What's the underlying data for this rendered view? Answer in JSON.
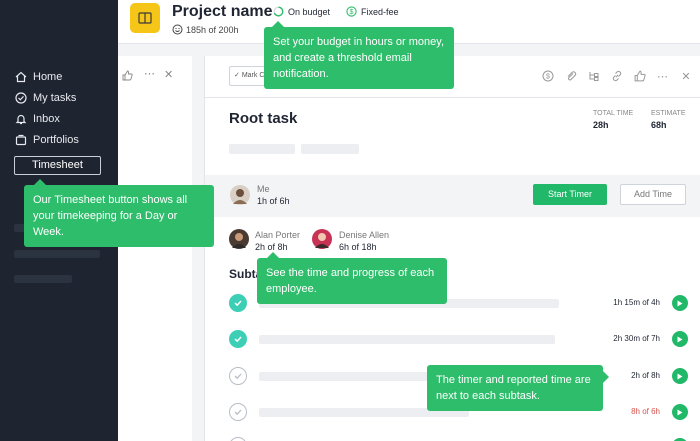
{
  "sidebar": {
    "items": [
      {
        "label": "Home",
        "icon": "home-icon"
      },
      {
        "label": "My tasks",
        "icon": "check-circle-icon"
      },
      {
        "label": "Inbox",
        "icon": "bell-icon"
      },
      {
        "label": "Portfolios",
        "icon": "folders-icon"
      }
    ],
    "timesheet_label": "Timesheet"
  },
  "header": {
    "project_name": "Project name",
    "budget_usage": "185h of 200h",
    "budget_status": "On budget",
    "billing_type": "Fixed-fee"
  },
  "task": {
    "mark_label": "Mark C",
    "title": "Root task",
    "total_time_label": "TOTAL TIME",
    "total_time": "28h",
    "estimate_label": "ESTIMATE",
    "estimate": "68h"
  },
  "people": {
    "me": {
      "name": "Me",
      "time": "1h of 6h"
    },
    "start_timer": "Start Timer",
    "add_time": "Add Time",
    "others": [
      {
        "name": "Alan Porter",
        "time": "2h of 8h"
      },
      {
        "name": "Denise Allen",
        "time": "6h of 18h"
      }
    ]
  },
  "subtasks": {
    "title": "Subta",
    "items": [
      {
        "time": "1h 15m of 4h",
        "done": true,
        "over": false
      },
      {
        "time": "2h 30m of 7h",
        "done": true,
        "over": false
      },
      {
        "time": "2h of 8h",
        "done": false,
        "over": false
      },
      {
        "time": "8h of 6h",
        "done": false,
        "over": true
      }
    ]
  },
  "tooltips": {
    "budget": "Set your budget in hours or money, and create a threshold email notification.",
    "timesheet": "Our Timesheet button shows all your timekeeping for a Day or Week.",
    "employee": "See the time and progress of each employee.",
    "timer": "The timer and reported time are next to each subtask."
  },
  "colors": {
    "accent": "#2ebd6b",
    "sidebar": "#1e2430",
    "project_icon": "#f5c518",
    "over_budget": "#d9534f"
  }
}
